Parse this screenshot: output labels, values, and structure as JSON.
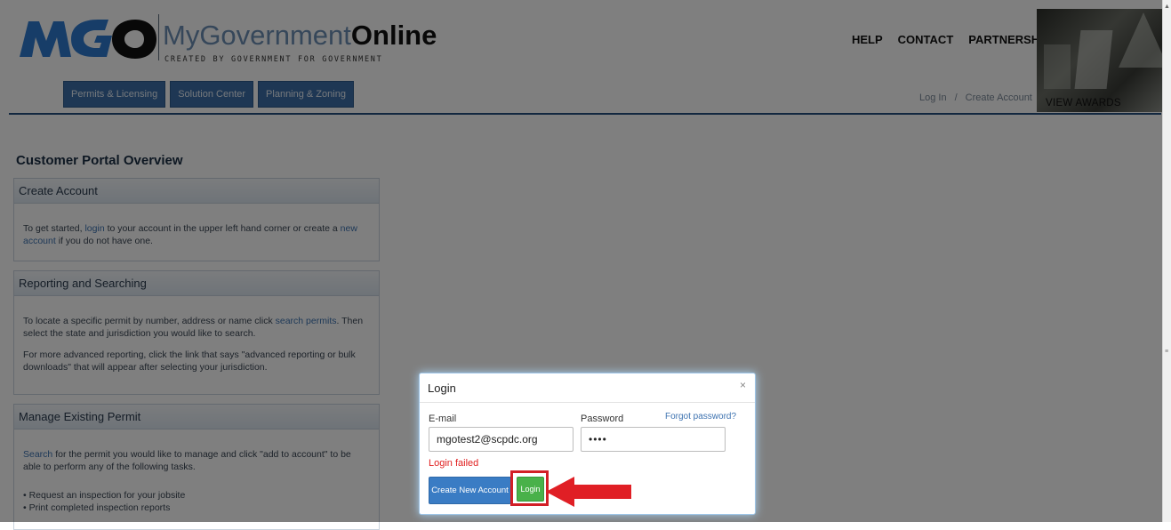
{
  "header": {
    "brand_prefix": "MyGovernment",
    "brand_suffix": "Online",
    "tagline": "CREATED BY GOVERNMENT FOR GOVERNMENT",
    "logo_text": "MGO",
    "nav_tabs": [
      "Permits & Licensing",
      "Solution Center",
      "Planning & Zoning"
    ],
    "top_links": [
      "HELP",
      "CONTACT",
      "PARTNERSHIP"
    ],
    "login_link": "Log In",
    "separator": "/",
    "create_account_link": "Create Account",
    "view_awards": "VIEW AWARDS"
  },
  "main": {
    "title": "Customer Portal Overview",
    "panels": {
      "create_account": {
        "heading": "Create Account",
        "text_1": "To get started, ",
        "link_login": "login",
        "text_2": " to your account in the upper left hand corner or create a ",
        "link_new_account": "new account",
        "text_3": " if you do not have one."
      },
      "reporting": {
        "heading": "Reporting and Searching",
        "p1_a": "To locate a specific permit by number, address or name click ",
        "p1_link": "search permits",
        "p1_b": ". Then select the state and jurisdiction you would like to search.",
        "p2": "For more advanced reporting, click the link that says \"advanced reporting or bulk downloads\" that will appear after selecting your jurisdiction."
      },
      "manage": {
        "heading": "Manage Existing Permit",
        "p1_link": "Search",
        "p1_text": " for the permit you would like to manage and click \"add to account\" to be able to perform any of the following tasks.",
        "bullet_1": "• Request an inspection for your jobsite",
        "bullet_2": "• Print completed inspection reports"
      }
    }
  },
  "login_modal": {
    "title": "Login",
    "close": "×",
    "email_label": "E-mail",
    "email_value": "mgotest2@scpdc.org",
    "password_label": "Password",
    "password_value": "••••",
    "forgot": "Forgot password?",
    "error": "Login failed",
    "create_button": "Create New Account",
    "login_button": "Login"
  },
  "colors": {
    "nav_tab": "#3d6fa8",
    "header_rule": "#244f7f",
    "error": "#e02020",
    "highlight_box": "#d21f26",
    "login_button": "#49b14a",
    "create_button": "#3a7cc4"
  }
}
